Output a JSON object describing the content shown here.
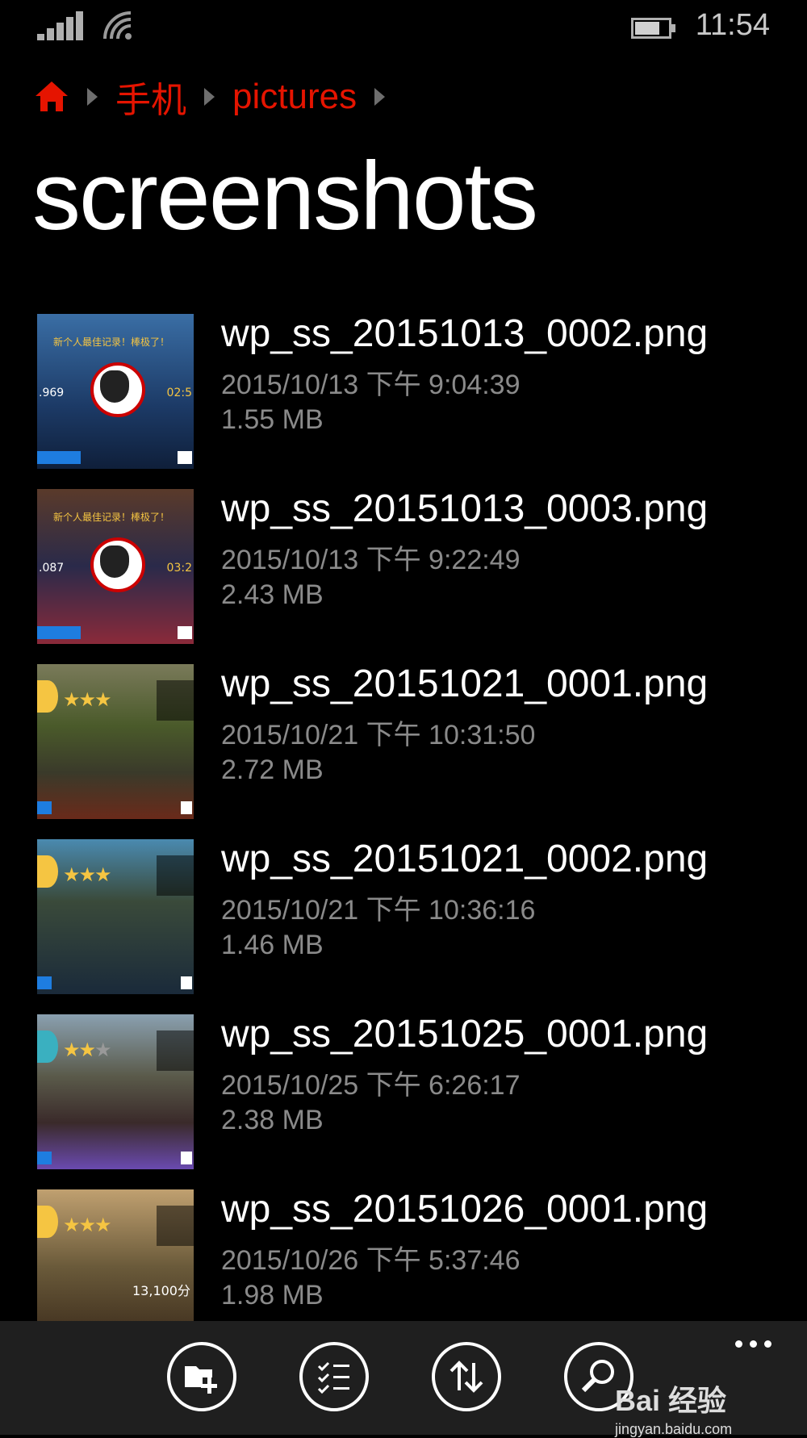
{
  "status": {
    "time": "11:54"
  },
  "breadcrumb": {
    "items": [
      "手机",
      "pictures"
    ]
  },
  "page": {
    "title": "screenshots"
  },
  "files": [
    {
      "name": "wp_ss_20151013_0002.png",
      "date": "2015/10/13 下午 9:04:39",
      "size": "1.55 MB",
      "thumb_caption": "新个人最佳记录！棒极了！",
      "thumb_left": ".969",
      "thumb_right": "02:5"
    },
    {
      "name": "wp_ss_20151013_0003.png",
      "date": "2015/10/13 下午 9:22:49",
      "size": "2.43 MB",
      "thumb_caption": "新个人最佳记录！棒极了！",
      "thumb_left": ".087",
      "thumb_right": "03:2"
    },
    {
      "name": "wp_ss_20151021_0001.png",
      "date": "2015/10/21 下午 10:31:50",
      "size": "2.72 MB",
      "stars": 3
    },
    {
      "name": "wp_ss_20151021_0002.png",
      "date": "2015/10/21 下午 10:36:16",
      "size": "1.46 MB",
      "stars": 3
    },
    {
      "name": "wp_ss_20151025_0001.png",
      "date": "2015/10/25 下午 6:26:17",
      "size": "2.38 MB",
      "stars": 2
    },
    {
      "name": "wp_ss_20151026_0001.png",
      "date": "2015/10/26 下午 5:37:46",
      "size": "1.98 MB",
      "stars": 3,
      "thumb_caption": "13,100分"
    }
  ],
  "colors": {
    "accent": "#e51400",
    "background": "#000000",
    "secondary_text": "#8a8a8a",
    "appbar": "#1f1f1f"
  },
  "appbar": {
    "buttons": [
      {
        "icon": "new-folder-icon"
      },
      {
        "icon": "select-icon"
      },
      {
        "icon": "sort-icon"
      },
      {
        "icon": "search-icon"
      }
    ]
  },
  "watermark": {
    "text": "Bai 经验",
    "url": "jingyan.baidu.com"
  }
}
